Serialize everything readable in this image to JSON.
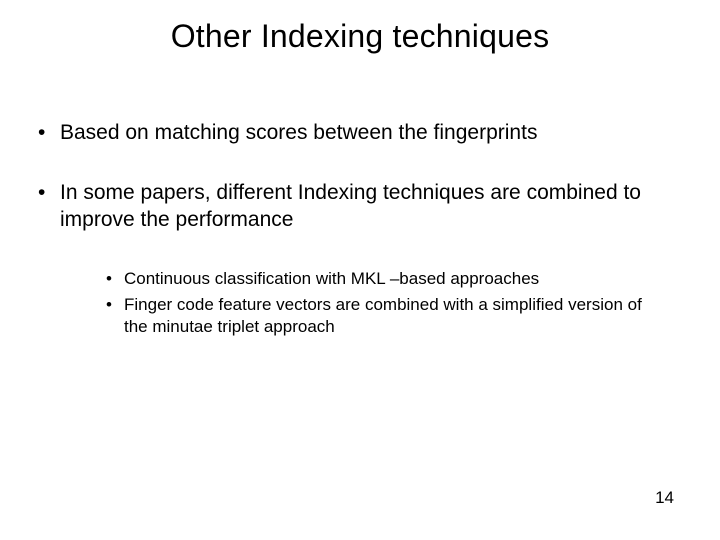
{
  "title": "Other Indexing techniques",
  "bullets": {
    "b1": "Based on matching scores between the fingerprints",
    "b2": "In some papers, different Indexing techniques are combined to improve the performance"
  },
  "subbullets": {
    "s1": "Continuous classification with MKL –based approaches",
    "s2": "Finger code feature vectors are combined with a simplified version of the minutae triplet approach"
  },
  "page_number": "14"
}
